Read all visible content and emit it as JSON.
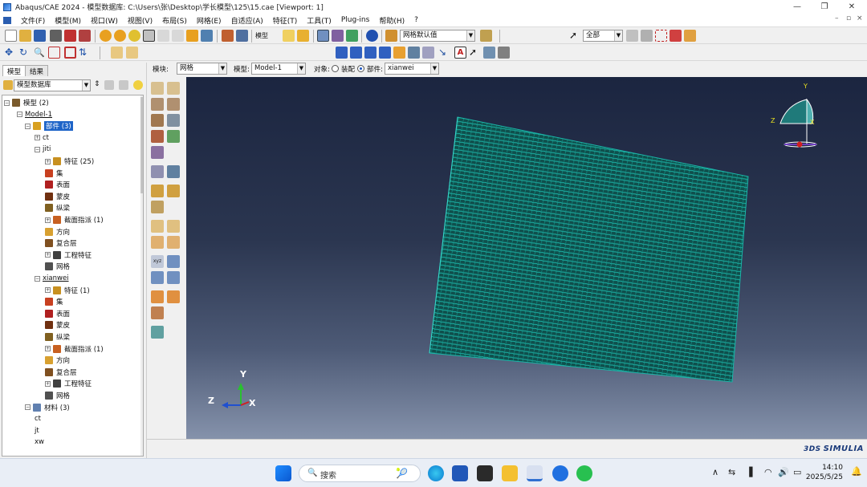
{
  "window": {
    "title": "Abaqus/CAE 2024 - 模型数据库: C:\\Users\\张\\Desktop\\学长模型\\125\\15.cae [Viewport: 1]",
    "min_glyph": "—",
    "max_glyph": "❐",
    "close_glyph": "✕"
  },
  "menu": {
    "items": [
      "文件(F)",
      "模型(M)",
      "视口(W)",
      "视图(V)",
      "布局(S)",
      "网格(E)",
      "自适应(A)",
      "特征(T)",
      "工具(T)",
      "Plug-ins",
      "帮助(H)",
      "?"
    ],
    "mdi_controls": [
      "–",
      "▫",
      "×"
    ]
  },
  "toolbar": {
    "mesh_default_label": "网格默认值",
    "selection_filter": "全部",
    "mesh_text_btn": "模型"
  },
  "context": {
    "module_label": "模块:",
    "module_value": "网格",
    "model_label": "模型:",
    "model_value": "Model-1",
    "object_label": "对象:",
    "object_assembly": "装配",
    "object_part": "部件:",
    "part_value": "xianwei"
  },
  "panel": {
    "tab_model": "模型",
    "tab_results": "结果",
    "db_selector": "模型数据库"
  },
  "tree": [
    {
      "label": "模型 (2)",
      "level": 0,
      "expander": "⊟",
      "icon": "models-icon",
      "color": "#7a5a2c"
    },
    {
      "label": "Model-1",
      "level": 1,
      "expander": "⊟",
      "icon": "",
      "color": "",
      "underline": true
    },
    {
      "label": "部件 (3)",
      "level": 2,
      "expander": "⊟",
      "icon": "parts-icon",
      "color": "#d8a020",
      "selected": true
    },
    {
      "label": "ct",
      "level": 3,
      "expander": "⊞",
      "icon": "",
      "color": ""
    },
    {
      "label": "jiti",
      "level": 3,
      "expander": "⊟",
      "icon": "",
      "color": ""
    },
    {
      "label": "特征 (25)",
      "level": 4,
      "expander": "⊞",
      "icon": "features-icon",
      "color": "#c89020"
    },
    {
      "label": "集",
      "level": 4,
      "expander": "",
      "icon": "sets-icon",
      "color": "#c84020"
    },
    {
      "label": "表面",
      "level": 4,
      "expander": "",
      "icon": "surfaces-icon",
      "color": "#b02020"
    },
    {
      "label": "蒙皮",
      "level": 4,
      "expander": "",
      "icon": "skins-icon",
      "color": "#703010"
    },
    {
      "label": "纵梁",
      "level": 4,
      "expander": "",
      "icon": "stringers-icon",
      "color": "#806020"
    },
    {
      "label": "截面指派 (1)",
      "level": 4,
      "expander": "⊞",
      "icon": "section-assignments-icon",
      "color": "#c86020"
    },
    {
      "label": "方向",
      "level": 4,
      "expander": "",
      "icon": "orientations-icon",
      "color": "#d8a030"
    },
    {
      "label": "复合层",
      "level": 4,
      "expander": "",
      "icon": "composite-layups-icon",
      "color": "#805020"
    },
    {
      "label": "工程特征",
      "level": 4,
      "expander": "⊞",
      "icon": "engineering-features-icon",
      "color": "#404040"
    },
    {
      "label": "网格",
      "level": 4,
      "expander": "",
      "icon": "mesh-icon",
      "color": "#505050"
    },
    {
      "label": "xianwei",
      "level": 3,
      "expander": "⊟",
      "icon": "",
      "color": "",
      "underline": true
    },
    {
      "label": "特征 (1)",
      "level": 4,
      "expander": "⊞",
      "icon": "features-icon",
      "color": "#c89020"
    },
    {
      "label": "集",
      "level": 4,
      "expander": "",
      "icon": "sets-icon",
      "color": "#c84020"
    },
    {
      "label": "表面",
      "level": 4,
      "expander": "",
      "icon": "surfaces-icon",
      "color": "#b02020"
    },
    {
      "label": "蒙皮",
      "level": 4,
      "expander": "",
      "icon": "skins-icon",
      "color": "#703010"
    },
    {
      "label": "纵梁",
      "level": 4,
      "expander": "",
      "icon": "stringers-icon",
      "color": "#806020"
    },
    {
      "label": "截面指派 (1)",
      "level": 4,
      "expander": "⊞",
      "icon": "section-assignments-icon",
      "color": "#c86020"
    },
    {
      "label": "方向",
      "level": 4,
      "expander": "",
      "icon": "orientations-icon",
      "color": "#d8a030"
    },
    {
      "label": "复合层",
      "level": 4,
      "expander": "",
      "icon": "composite-layups-icon",
      "color": "#805020"
    },
    {
      "label": "工程特征",
      "level": 4,
      "expander": "⊞",
      "icon": "engineering-features-icon",
      "color": "#404040"
    },
    {
      "label": "网格",
      "level": 4,
      "expander": "",
      "icon": "mesh-icon",
      "color": "#505050"
    },
    {
      "label": "材料 (3)",
      "level": 2,
      "expander": "⊟",
      "icon": "materials-icon",
      "color": "#6080b0"
    },
    {
      "label": "ct",
      "level": 3,
      "expander": "",
      "icon": "",
      "color": ""
    },
    {
      "label": "jt",
      "level": 3,
      "expander": "",
      "icon": "",
      "color": ""
    },
    {
      "label": "xw",
      "level": 3,
      "expander": "",
      "icon": "",
      "color": ""
    }
  ],
  "viewport": {
    "mesh_color": "#1bb5a8",
    "background_top": "#1b2540",
    "background_bottom": "#8592ab",
    "triad": {
      "x": "X",
      "y": "Y",
      "z": "Z"
    },
    "view_cube_labels": {
      "x": "X",
      "y": "Y",
      "z": "Z"
    }
  },
  "status": {
    "brand": "SIMULIA",
    "brand_logo": "3DS"
  },
  "taskbar": {
    "search_placeholder": "搜索",
    "time": "14:10",
    "date": "2025/5/25"
  }
}
